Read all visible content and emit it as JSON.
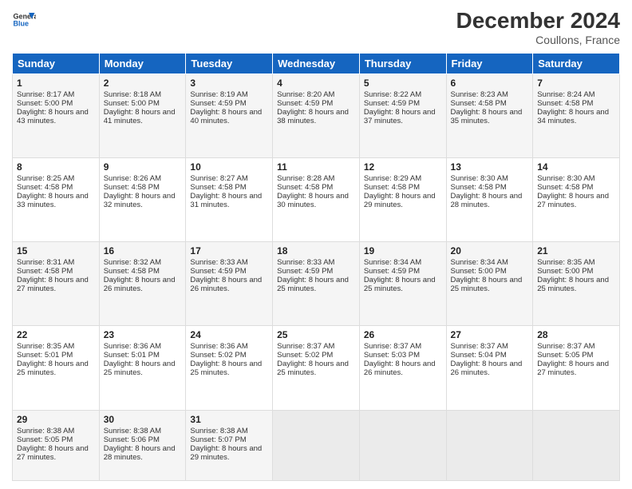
{
  "header": {
    "logo_line1": "General",
    "logo_line2": "Blue",
    "month": "December 2024",
    "location": "Coullons, France"
  },
  "days_of_week": [
    "Sunday",
    "Monday",
    "Tuesday",
    "Wednesday",
    "Thursday",
    "Friday",
    "Saturday"
  ],
  "weeks": [
    [
      {
        "day": "1",
        "sunrise": "Sunrise: 8:17 AM",
        "sunset": "Sunset: 5:00 PM",
        "daylight": "Daylight: 8 hours and 43 minutes."
      },
      {
        "day": "2",
        "sunrise": "Sunrise: 8:18 AM",
        "sunset": "Sunset: 5:00 PM",
        "daylight": "Daylight: 8 hours and 41 minutes."
      },
      {
        "day": "3",
        "sunrise": "Sunrise: 8:19 AM",
        "sunset": "Sunset: 4:59 PM",
        "daylight": "Daylight: 8 hours and 40 minutes."
      },
      {
        "day": "4",
        "sunrise": "Sunrise: 8:20 AM",
        "sunset": "Sunset: 4:59 PM",
        "daylight": "Daylight: 8 hours and 38 minutes."
      },
      {
        "day": "5",
        "sunrise": "Sunrise: 8:22 AM",
        "sunset": "Sunset: 4:59 PM",
        "daylight": "Daylight: 8 hours and 37 minutes."
      },
      {
        "day": "6",
        "sunrise": "Sunrise: 8:23 AM",
        "sunset": "Sunset: 4:58 PM",
        "daylight": "Daylight: 8 hours and 35 minutes."
      },
      {
        "day": "7",
        "sunrise": "Sunrise: 8:24 AM",
        "sunset": "Sunset: 4:58 PM",
        "daylight": "Daylight: 8 hours and 34 minutes."
      }
    ],
    [
      {
        "day": "8",
        "sunrise": "Sunrise: 8:25 AM",
        "sunset": "Sunset: 4:58 PM",
        "daylight": "Daylight: 8 hours and 33 minutes."
      },
      {
        "day": "9",
        "sunrise": "Sunrise: 8:26 AM",
        "sunset": "Sunset: 4:58 PM",
        "daylight": "Daylight: 8 hours and 32 minutes."
      },
      {
        "day": "10",
        "sunrise": "Sunrise: 8:27 AM",
        "sunset": "Sunset: 4:58 PM",
        "daylight": "Daylight: 8 hours and 31 minutes."
      },
      {
        "day": "11",
        "sunrise": "Sunrise: 8:28 AM",
        "sunset": "Sunset: 4:58 PM",
        "daylight": "Daylight: 8 hours and 30 minutes."
      },
      {
        "day": "12",
        "sunrise": "Sunrise: 8:29 AM",
        "sunset": "Sunset: 4:58 PM",
        "daylight": "Daylight: 8 hours and 29 minutes."
      },
      {
        "day": "13",
        "sunrise": "Sunrise: 8:30 AM",
        "sunset": "Sunset: 4:58 PM",
        "daylight": "Daylight: 8 hours and 28 minutes."
      },
      {
        "day": "14",
        "sunrise": "Sunrise: 8:30 AM",
        "sunset": "Sunset: 4:58 PM",
        "daylight": "Daylight: 8 hours and 27 minutes."
      }
    ],
    [
      {
        "day": "15",
        "sunrise": "Sunrise: 8:31 AM",
        "sunset": "Sunset: 4:58 PM",
        "daylight": "Daylight: 8 hours and 27 minutes."
      },
      {
        "day": "16",
        "sunrise": "Sunrise: 8:32 AM",
        "sunset": "Sunset: 4:58 PM",
        "daylight": "Daylight: 8 hours and 26 minutes."
      },
      {
        "day": "17",
        "sunrise": "Sunrise: 8:33 AM",
        "sunset": "Sunset: 4:59 PM",
        "daylight": "Daylight: 8 hours and 26 minutes."
      },
      {
        "day": "18",
        "sunrise": "Sunrise: 8:33 AM",
        "sunset": "Sunset: 4:59 PM",
        "daylight": "Daylight: 8 hours and 25 minutes."
      },
      {
        "day": "19",
        "sunrise": "Sunrise: 8:34 AM",
        "sunset": "Sunset: 4:59 PM",
        "daylight": "Daylight: 8 hours and 25 minutes."
      },
      {
        "day": "20",
        "sunrise": "Sunrise: 8:34 AM",
        "sunset": "Sunset: 5:00 PM",
        "daylight": "Daylight: 8 hours and 25 minutes."
      },
      {
        "day": "21",
        "sunrise": "Sunrise: 8:35 AM",
        "sunset": "Sunset: 5:00 PM",
        "daylight": "Daylight: 8 hours and 25 minutes."
      }
    ],
    [
      {
        "day": "22",
        "sunrise": "Sunrise: 8:35 AM",
        "sunset": "Sunset: 5:01 PM",
        "daylight": "Daylight: 8 hours and 25 minutes."
      },
      {
        "day": "23",
        "sunrise": "Sunrise: 8:36 AM",
        "sunset": "Sunset: 5:01 PM",
        "daylight": "Daylight: 8 hours and 25 minutes."
      },
      {
        "day": "24",
        "sunrise": "Sunrise: 8:36 AM",
        "sunset": "Sunset: 5:02 PM",
        "daylight": "Daylight: 8 hours and 25 minutes."
      },
      {
        "day": "25",
        "sunrise": "Sunrise: 8:37 AM",
        "sunset": "Sunset: 5:02 PM",
        "daylight": "Daylight: 8 hours and 25 minutes."
      },
      {
        "day": "26",
        "sunrise": "Sunrise: 8:37 AM",
        "sunset": "Sunset: 5:03 PM",
        "daylight": "Daylight: 8 hours and 26 minutes."
      },
      {
        "day": "27",
        "sunrise": "Sunrise: 8:37 AM",
        "sunset": "Sunset: 5:04 PM",
        "daylight": "Daylight: 8 hours and 26 minutes."
      },
      {
        "day": "28",
        "sunrise": "Sunrise: 8:37 AM",
        "sunset": "Sunset: 5:05 PM",
        "daylight": "Daylight: 8 hours and 27 minutes."
      }
    ],
    [
      {
        "day": "29",
        "sunrise": "Sunrise: 8:38 AM",
        "sunset": "Sunset: 5:05 PM",
        "daylight": "Daylight: 8 hours and 27 minutes."
      },
      {
        "day": "30",
        "sunrise": "Sunrise: 8:38 AM",
        "sunset": "Sunset: 5:06 PM",
        "daylight": "Daylight: 8 hours and 28 minutes."
      },
      {
        "day": "31",
        "sunrise": "Sunrise: 8:38 AM",
        "sunset": "Sunset: 5:07 PM",
        "daylight": "Daylight: 8 hours and 29 minutes."
      },
      null,
      null,
      null,
      null
    ]
  ]
}
